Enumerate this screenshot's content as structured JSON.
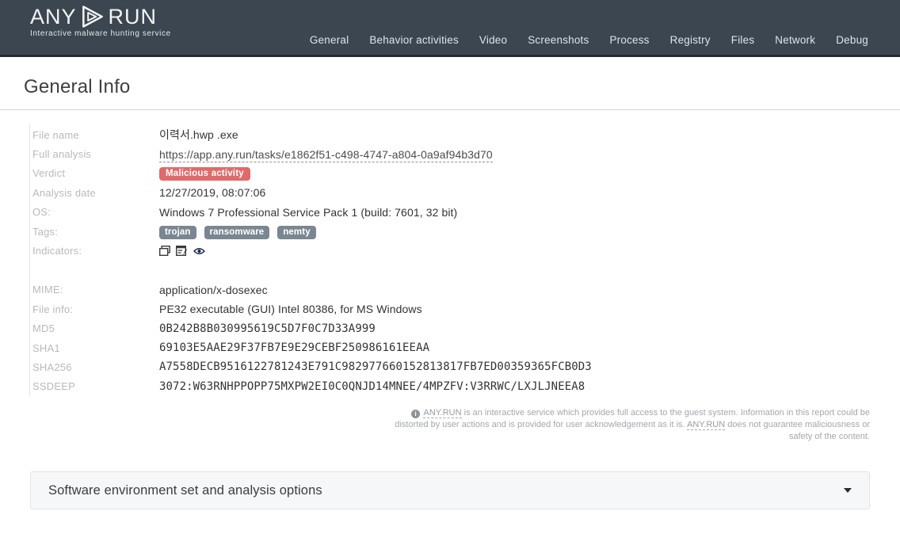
{
  "header": {
    "logo_any": "ANY",
    "logo_run": "RUN",
    "tagline": "Interactive malware hunting service",
    "nav": [
      {
        "label": "General"
      },
      {
        "label": "Behavior activities"
      },
      {
        "label": "Video"
      },
      {
        "label": "Screenshots"
      },
      {
        "label": "Process"
      },
      {
        "label": "Registry"
      },
      {
        "label": "Files"
      },
      {
        "label": "Network"
      },
      {
        "label": "Debug"
      }
    ]
  },
  "page": {
    "title": "General Info"
  },
  "general": {
    "file_name_label": "File name",
    "file_name": "이력서.hwp .exe",
    "full_analysis_label": "Full analysis",
    "full_analysis_url": "https://app.any.run/tasks/e1862f51-c498-4747-a804-0a9af94b3d70",
    "verdict_label": "Verdict",
    "verdict": "Malicious activity",
    "analysis_date_label": "Analysis date",
    "analysis_date": "12/27/2019, 08:07:06",
    "os_label": "OS:",
    "os": "Windows 7 Professional Service Pack 1 (build: 7601, 32 bit)",
    "tags_label": "Tags:",
    "tags": [
      "trojan",
      "ransomware",
      "nemty"
    ],
    "indicators_label": "Indicators:",
    "indicators": [
      "cascade-windows-icon",
      "window-edit-icon",
      "eye-icon"
    ],
    "mime_label": "MIME:",
    "mime": "application/x-dosexec",
    "file_info_label": "File info:",
    "file_info": "PE32 executable (GUI) Intel 80386, for MS Windows",
    "md5_label": "MD5",
    "md5": "0B242B8B030995619C5D7F0C7D33A999",
    "sha1_label": "SHA1",
    "sha1": "69103E5AAE29F37FB7E9E29CEBF250986161EEAA",
    "sha256_label": "SHA256",
    "sha256": "A7558DECB9516122781243E791C982977660152813817FB7ED00359365FCB0D3",
    "ssdeep_label": "SSDEEP",
    "ssdeep": "3072:W63RNHPPOPP75MXPW2EI0C0QNJD14MNEE/4MPZFV:V3RRWC/LXJLJNEEA8"
  },
  "disclaimer": {
    "brand1": "ANY.RUN",
    "text1": "is an interactive service which provides full access to the guest system. Information in this report could be distorted by user actions and is provided for user acknowledgement as it is.",
    "brand2": "ANY.RUN",
    "text2": "does not guarantee maliciousness or safety of the content."
  },
  "accordion": {
    "title": "Software environment set and analysis options"
  },
  "colors": {
    "header_bg": "#3b4651",
    "header_border": "#232c34",
    "verdict_bg": "#e06a6a",
    "tag_bg": "#7a8691",
    "label_text": "#b6babd",
    "value_text": "#333333",
    "disclaimer_text": "#a2a8ae",
    "accordion_bg": "#f6f7f9"
  }
}
